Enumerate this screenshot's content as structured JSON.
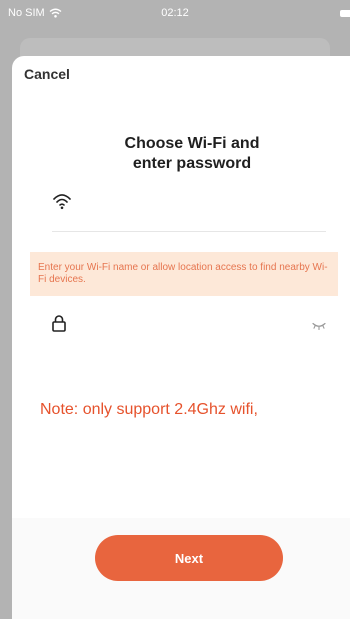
{
  "status_bar": {
    "carrier": "No SIM",
    "time": "02:12"
  },
  "header": {
    "cancel_label": "Cancel"
  },
  "title": {
    "line1": "Choose Wi-Fi and",
    "line2": "enter password"
  },
  "wifi_field": {
    "value": "",
    "icon": "wifi-icon"
  },
  "hint": {
    "text": "Enter your Wi-Fi name or allow location access to find nearby Wi-Fi devices."
  },
  "password_field": {
    "value": "",
    "icon": "lock-icon",
    "visibility_icon": "eye-closed-icon"
  },
  "note": {
    "text": "Note: only support 2.4Ghz wifi,"
  },
  "footer": {
    "next_label": "Next"
  },
  "colors": {
    "accent": "#e8653e",
    "note_text": "#e6522c",
    "hint_background": "#fde8d8",
    "hint_text": "#e6754f"
  }
}
